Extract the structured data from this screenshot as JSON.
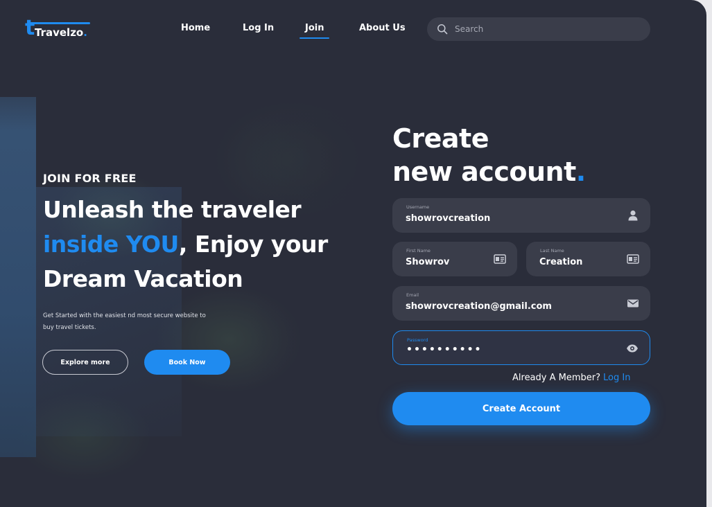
{
  "brand": {
    "logo_letter": "t",
    "name": "Travelzo",
    "dot": ".",
    "accent_color": "#1f8bf0"
  },
  "nav": {
    "items": [
      {
        "label": "Home",
        "active": false
      },
      {
        "label": "Log In",
        "active": false
      },
      {
        "label": "Join",
        "active": true
      },
      {
        "label": "About Us",
        "active": false
      }
    ]
  },
  "search": {
    "placeholder": "Search",
    "icon": "search-icon"
  },
  "hero": {
    "eyebrow": "JOIN FOR FREE",
    "headline_part1": "Unleash the traveler",
    "headline_accent": "inside YOU",
    "headline_part2": ", Enjoy your Dream Vacation",
    "subtext": "Get Started with the easiest nd most secure website to buy travel tickets.",
    "explore_label": "Explore more",
    "book_label": "Book Now"
  },
  "form": {
    "title_line1": "Create",
    "title_line2": "new account",
    "title_dot": ".",
    "username": {
      "label": "Username",
      "value": "showrovcreation",
      "icon": "user-icon"
    },
    "first_name": {
      "label": "First Name",
      "value": "Showrov",
      "icon": "id-card-icon"
    },
    "last_name": {
      "label": "Last Name",
      "value": "Creation",
      "icon": "id-card-icon"
    },
    "email": {
      "label": "Email",
      "value": "showrovcreation@gmail.com",
      "icon": "mail-icon"
    },
    "password": {
      "label": "Password",
      "value": "••••••••••",
      "icon": "eye-icon"
    },
    "member_text": "Already A Member?",
    "login_link": "Log In",
    "submit_label": "Create Account"
  }
}
